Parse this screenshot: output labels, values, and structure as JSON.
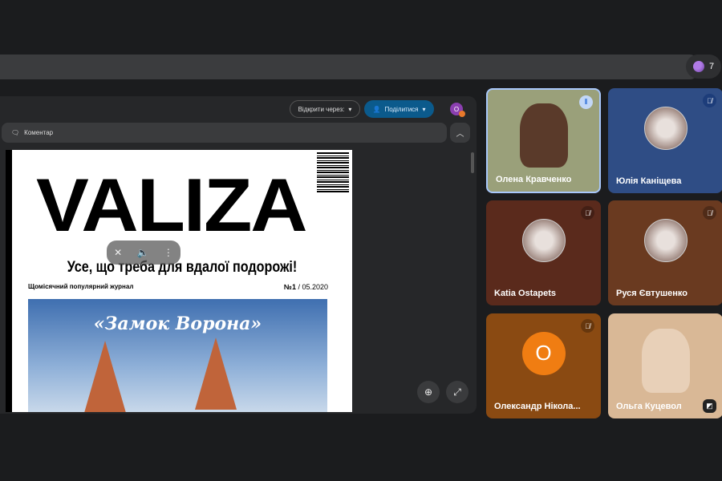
{
  "participants_count": "7",
  "toolbar": {
    "open_with_label": "Відкрити через:",
    "share_label": "Поділитися",
    "user_initial": "О"
  },
  "comment_label": "Коментар",
  "document": {
    "title": "VALIZA",
    "tagline": "Усе, що треба для вдалої подорожі!",
    "subtitle": "Щомісячний популярний журнал",
    "issue_no": "№1",
    "issue_date": " / 05.2020",
    "photo_title": "«Замок Ворона»"
  },
  "tiles": [
    {
      "name": "Олена Кравченко",
      "status": "speaking",
      "bg": "#9aa07a"
    },
    {
      "name": "Юлія Каніщева",
      "status": "muted",
      "bg": "#2f4d85"
    },
    {
      "name": "Katia Ostapets",
      "status": "muted",
      "bg": "#5a2a1c"
    },
    {
      "name": "Руся Євтушенко",
      "status": "muted",
      "bg": "#6a3a20"
    },
    {
      "name": "Олександр Нікола...",
      "status": "muted",
      "bg": "#8a4a12",
      "initial": "О"
    },
    {
      "name": "Ольга Куцевол",
      "status": "video",
      "bg": "#d9b896"
    }
  ],
  "colors": {
    "accent": "#0b5a8c",
    "background": "#1b1c1e"
  }
}
